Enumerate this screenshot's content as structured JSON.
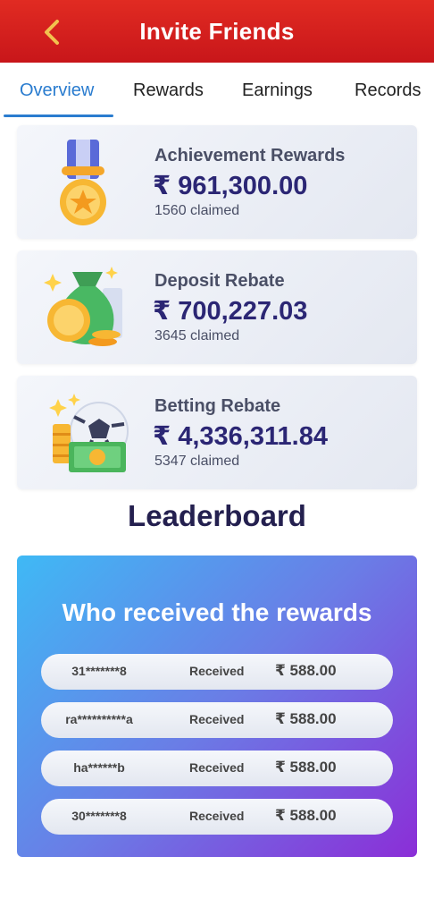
{
  "header": {
    "title": "Invite Friends",
    "back_icon": "chevron-left-icon"
  },
  "tabs": [
    {
      "label": "Overview",
      "active": true
    },
    {
      "label": "Rewards",
      "active": false
    },
    {
      "label": "Earnings",
      "active": false
    },
    {
      "label": "Records",
      "active": false
    }
  ],
  "cards": [
    {
      "title": "Achievement Rewards",
      "amount": "₹ 961,300.00",
      "claimed": "1560 claimed",
      "icon": "medal-icon"
    },
    {
      "title": "Deposit Rebate",
      "amount": "₹ 700,227.03",
      "claimed": "3645 claimed",
      "icon": "money-bag-icon"
    },
    {
      "title": "Betting Rebate",
      "amount": "₹ 4,336,311.84",
      "claimed": "5347 claimed",
      "icon": "soccer-ball-cash-icon"
    }
  ],
  "leaderboard": {
    "heading": "Leaderboard",
    "panel_title": "Who received the rewards",
    "rows": [
      {
        "user": "31*******8",
        "status": "Received",
        "amount": "₹ 588.00"
      },
      {
        "user": "ra**********a",
        "status": "Received",
        "amount": "₹ 588.00"
      },
      {
        "user": "ha******b",
        "status": "Received",
        "amount": "₹ 588.00"
      },
      {
        "user": "30*******8",
        "status": "Received",
        "amount": "₹ 588.00"
      }
    ]
  },
  "colors": {
    "header_red": "#d81e1e",
    "active_tab": "#2a7ccf",
    "amount_text": "#2b2674",
    "panel_gradient_start": "#3fb9f5",
    "panel_gradient_end": "#8b2ed7"
  }
}
